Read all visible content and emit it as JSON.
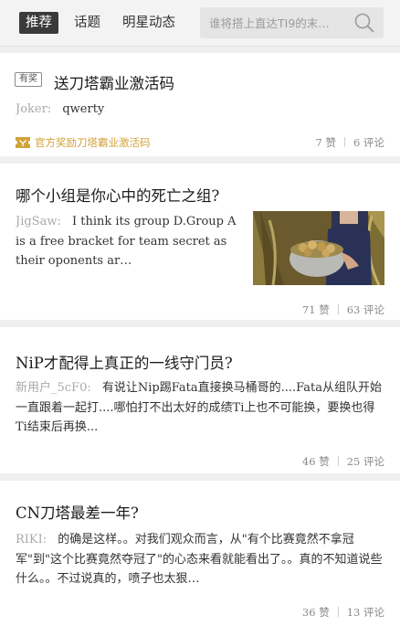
{
  "nav": {
    "tabs": [
      {
        "label": "推荐",
        "active": true
      },
      {
        "label": "话题",
        "active": false
      },
      {
        "label": "明星动态",
        "active": false
      }
    ],
    "search_placeholder": "谁将搭上直达TI9的末…",
    "search_icon": "search-icon"
  },
  "colors": {
    "accent_gold": "#d2a23b",
    "tab_active_bg": "#3a3a3a"
  },
  "posts": [
    {
      "tag": "有奖",
      "title": "送刀塔霸业激活码",
      "author": "Joker:",
      "text": "qwerty",
      "promo": "官方奖励刀塔霸业激活码",
      "promo_icon": "ticket-icon",
      "likes": "7 赞",
      "comments": "6 评论"
    },
    {
      "title": "哪个小组是你心中的死亡之组?",
      "author": "JigSaw:",
      "text": "I think its group D.Group A is a free bracket for team secret as their oponents ar…",
      "thumbnail": "woman-harvesting-potatoes-photo",
      "likes": "71 赞",
      "comments": "63 评论"
    },
    {
      "title": "NiP才配得上真正的一线守门员?",
      "author": "新用户_5cF0:",
      "text": "有说让Nip踢Fata直接换马桶哥的....Fata从组队开始一直跟着一起打....哪怕打不出太好的成绩Ti上也不可能换，要换也得Ti结束后再换...",
      "likes": "46 赞",
      "comments": "25 评论"
    },
    {
      "title": "CN刀塔最差一年?",
      "author": "RIKI:",
      "text": "的确是这样。。对我们观众而言，从\"有个比赛竟然不拿冠军\"到\"这个比赛竟然夺冠了\"的心态来看就能看出了。。真的不知道说些什么。。不过说真的，喷子也太狠…",
      "likes": "36 赞",
      "comments": "13 评论"
    }
  ]
}
